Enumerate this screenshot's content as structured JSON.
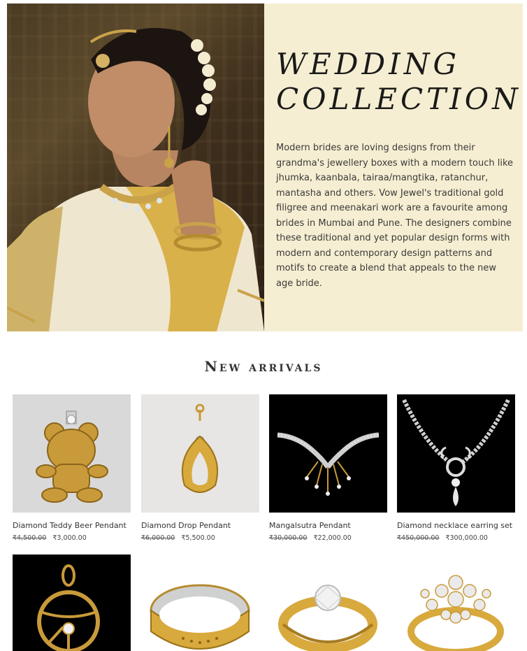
{
  "hero": {
    "title_line1": "WEDDING",
    "title_line2": "COLLECTION",
    "description": "Modern brides are loving designs from their grandma's jewellery boxes with a modern touch like jhumka, kaanbala, tairaa/mangtika, ratanchur, mantasha and others. Vow Jewel's traditional gold filigree and meenakari work are a favourite among brides in Mumbai and Pune. The designers combine these traditional and yet popular design forms with modern and contemporary design patterns and motifs to create a blend that appeals to the new age bride.",
    "background_color": "#f6eed2"
  },
  "section": {
    "title": "New arrivals"
  },
  "products": [
    {
      "name": "Diamond Teddy Beer Pendant",
      "old_price": "₹4,500.00",
      "price": "₹3,000.00"
    },
    {
      "name": "Diamond Drop Pendant",
      "old_price": "₹6,000.00",
      "price": "₹5,500.00"
    },
    {
      "name": "Mangalsutra Pendant",
      "old_price": "₹30,000.00",
      "price": "₹22,000.00"
    },
    {
      "name": "Diamond necklace earring set",
      "old_price": "₹450,000.00",
      "price": "₹300,000.00"
    }
  ]
}
